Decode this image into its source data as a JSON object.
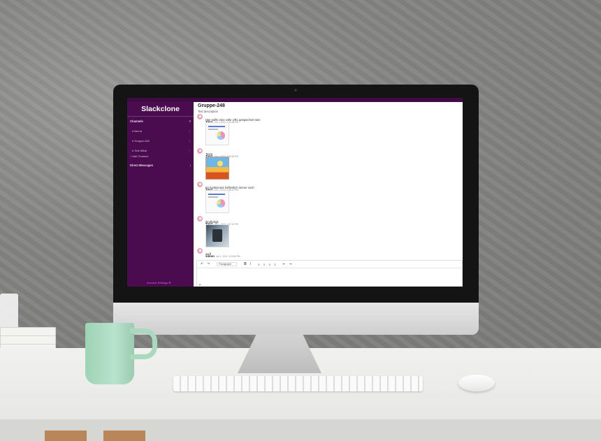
{
  "app": {
    "title": "Slackclone"
  },
  "sidebar": {
    "channels_header": "Channels",
    "channels_chevron": "˅",
    "channels": [
      {
        "name": "# Bernd",
        "menu": "⋮"
      },
      {
        "name": "# Gruppe-248",
        "menu": "⋮"
      },
      {
        "name": "# Test Mihai",
        "menu": "⋮"
      }
    ],
    "add_channel": "+ Add Channel",
    "dm_header": "Direct Messages",
    "dm_chevron": "›",
    "logout": "Account Settings ⚙"
  },
  "channel": {
    "title": "Gruppe-248",
    "description": "Test description"
  },
  "messages": [
    {
      "author": "Tim2",
      "time": "Jun 1, 2022, 1:19:28 PM",
      "text": "Hier sollte eine volle URL gespeichert sein",
      "attachment": "chart-image"
    },
    {
      "author": "Tim2",
      "time": "Jun 1, 2022, 2:09:53 PM",
      "text": "Test3",
      "attachment": "colorful-image"
    },
    {
      "author": "Tim2",
      "time": "Jun 1, 2022, 2:35:21 PM",
      "text": "Es funktioniert hoffentlich immer noch",
      "attachment": "chart-image"
    },
    {
      "author": "Tim2",
      "time": "Jun 1, 2022, 2:37:10 PM",
      "text": "jhndhdsjjs",
      "attachment": "photo-image"
    },
    {
      "author": "simon",
      "time": "Jun 1, 2022, 3:15:30 PM",
      "text": "asdf",
      "attachment": ""
    }
  ],
  "editor": {
    "undo": "↶",
    "redo": "↷",
    "block_format": "Paragraph",
    "bold": "B",
    "italic": "I",
    "align_left": "≡",
    "align_center": "≡",
    "align_right": "≡",
    "justify": "≡",
    "outdent": "⇤",
    "indent": "⇥",
    "send_icon": "➤"
  },
  "colors": {
    "sidebar": "#4a0b4f",
    "sidebar_top": "#3f0b44",
    "avatar": "#e7a8c4",
    "logout": "#d46bd7"
  }
}
